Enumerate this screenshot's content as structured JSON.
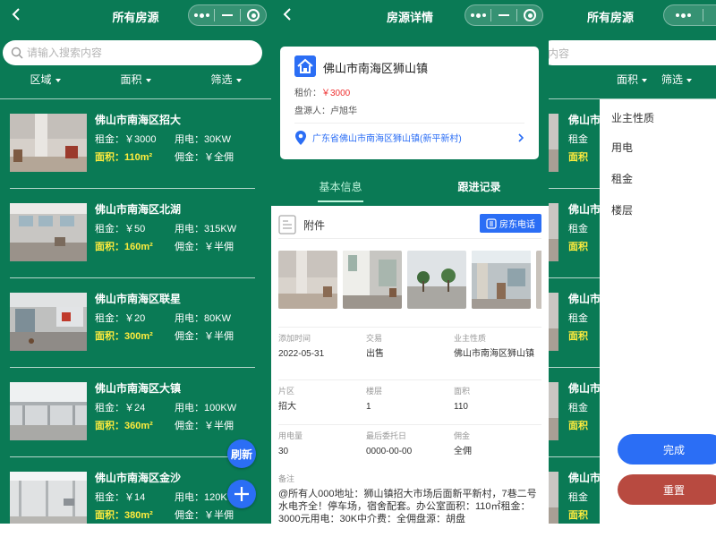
{
  "panels": {
    "list": {
      "title": "所有房源",
      "search_placeholder": "请输入搜索内容",
      "filters": [
        "区域",
        "面积",
        "筛选"
      ],
      "rent_label": "租金：",
      "power_label": "用电：",
      "area_label": "面积：",
      "commission_label": "佣金：",
      "items": [
        {
          "name": "佛山市南海区招大",
          "rent": "￥3000",
          "power": "30KW",
          "area": "110m²",
          "commission": "￥全佣"
        },
        {
          "name": "佛山市南海区北湖",
          "rent": "￥50",
          "power": "315KW",
          "area": "160m²",
          "commission": "￥半佣"
        },
        {
          "name": "佛山市南海区联星",
          "rent": "￥20",
          "power": "80KW",
          "area": "300m²",
          "commission": "￥半佣"
        },
        {
          "name": "佛山市南海区大镇",
          "rent": "￥24",
          "power": "100KW",
          "area": "360m²",
          "commission": "￥半佣"
        },
        {
          "name": "佛山市南海区金沙",
          "rent": "￥14",
          "power": "120KW",
          "area": "380m²",
          "commission": "￥半佣"
        }
      ],
      "refresh_label": "刷新",
      "add_label": "+"
    },
    "detail": {
      "title": "房源详情",
      "address": "佛山市南海区狮山镇",
      "price_label": "租价：",
      "price": "￥3000",
      "owner_label": "盘源人：",
      "owner": "卢旭华",
      "location": "广东省佛山市南海区狮山镇(新平新村)",
      "tabs": [
        "基本信息",
        "跟进记录"
      ],
      "attachment_label": "附件",
      "call_button": "房东电话",
      "fields": [
        {
          "label": "添加时间",
          "value": "2022-05-31"
        },
        {
          "label": "交易",
          "value": "出售"
        },
        {
          "label": "业主性质",
          "value": "佛山市南海区狮山镇"
        },
        {
          "label": "片区",
          "value": "招大"
        },
        {
          "label": "楼层",
          "value": "1"
        },
        {
          "label": "面积",
          "value": "110"
        },
        {
          "label": "用电量",
          "value": "30"
        },
        {
          "label": "最后委托日",
          "value": "0000-00-00"
        },
        {
          "label": "佣金",
          "value": "全佣"
        }
      ],
      "remark_label": "备注",
      "remark": "@所有人000地址：狮山镇招大市场后面新平新村，7巷二号水电齐全！停车场，宿舍配套。办公室面积：110㎡租金：3000元用电：30K中介费：全佣盘源：胡盘"
    },
    "filter": {
      "title": "所有房源",
      "search_placeholder_tail": "内容",
      "filters": [
        "面积",
        "筛选"
      ],
      "options": [
        "业主性质",
        "用电",
        "租金",
        "楼层"
      ],
      "confirm_label": "完成",
      "reset_label": "重置",
      "list_names": [
        "佛山市",
        "佛山市",
        "佛山市",
        "佛山市",
        "佛山市"
      ],
      "rent_partial": [
        "租金",
        "租金",
        "租金",
        "租金",
        "租金"
      ],
      "area_partial": [
        "面积",
        "面积",
        "面积",
        "面积",
        "面积"
      ]
    }
  },
  "colors": {
    "brand_green": "#0a7a55",
    "accent_blue": "#2b6ef5",
    "price_red": "#e33333",
    "highlight_yellow": "#ffec3d",
    "reset_red": "#b84a40"
  }
}
